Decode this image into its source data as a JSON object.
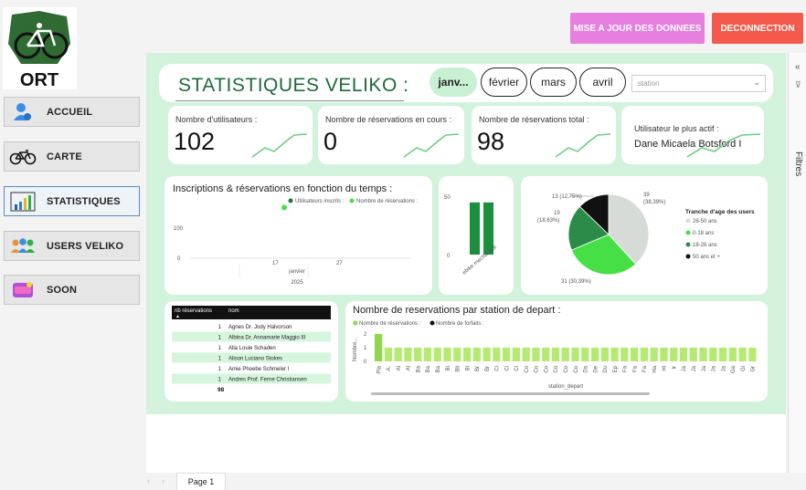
{
  "logo": {
    "text": "ORT"
  },
  "nav": [
    {
      "label": "ACCUEIL",
      "icon": "user-icon"
    },
    {
      "label": "CARTE",
      "icon": "bicycle-icon"
    },
    {
      "label": "STATISTIQUES",
      "icon": "bar-chart-icon"
    },
    {
      "label": "USERS VELIKO",
      "icon": "users-icon"
    },
    {
      "label": "SOON",
      "icon": "soon-icon"
    }
  ],
  "actions": {
    "update_label": "MISE A JOUR DES DONNEES",
    "logout_label": "DECONNECTION"
  },
  "filters": {
    "label": "Filtres",
    "collapse": "«",
    "expand": "⊽"
  },
  "header": {
    "title": "STATISTIQUES VELIKO :",
    "months": [
      "janv...",
      "février",
      "mars",
      "avril"
    ],
    "selected_month": "janv...",
    "station_placeholder": "station"
  },
  "kpis": {
    "users": {
      "label": "Nombre d'utilisateurs :",
      "value": "102"
    },
    "ongoing": {
      "label": "Nombre de réservations en cours :",
      "value": "0"
    },
    "total": {
      "label": "Nombre de réservations total :",
      "value": "98"
    },
    "active": {
      "label": "Utilisateur le plus actif :",
      "value": "Dane Micaela Botsford I"
    }
  },
  "colors": {
    "accent_green": "#4cdc4c",
    "dark_green": "#1f6a3b",
    "pink": "#e77fe0",
    "red": "#f45a4b"
  },
  "chart_data": [
    {
      "type": "scatter",
      "title": "Inscriptions & réservations en fonction du temps :",
      "legend": [
        "Utilisateurs inscrits :",
        "Nombre de réservations :"
      ],
      "y_ticks": [
        "100",
        "0"
      ],
      "x_ticks": [
        "17",
        "27"
      ],
      "xlabel_lines": [
        "janvier",
        "2025"
      ],
      "series": [
        {
          "name": "Utilisateurs inscrits :",
          "color": "#1f7a3a",
          "points": []
        },
        {
          "name": "Nombre de réservations :",
          "color": "#4cdc4c",
          "points": [
            {
              "x": 12,
              "y": 100
            }
          ]
        }
      ],
      "xlim": [
        10,
        31
      ],
      "ylim": [
        0,
        120
      ]
    },
    {
      "type": "bar",
      "categories": [
        "ebike",
        "mechanical"
      ],
      "values": [
        52,
        52
      ],
      "y_ticks": [
        "50",
        "0"
      ],
      "ylim": [
        0,
        60
      ],
      "color": "#1a8f3c",
      "category_label": "ebike mechanical"
    },
    {
      "type": "pie",
      "legend_title": "Tranche d'age des users",
      "slices": [
        {
          "name": "26-50 ans",
          "value": 39,
          "label": "39 (38,39%)",
          "color": "#d7dbd7"
        },
        {
          "name": "0-18 ans",
          "value": 31,
          "label": "31 (30,39%)",
          "color": "#46e046"
        },
        {
          "name": "18-26 ans",
          "value": 19,
          "label": "19 (18,63%)",
          "color": "#2a8c48"
        },
        {
          "name": "50 ans et +",
          "value": 13,
          "label": "13 (12,75%)",
          "color": "#111111"
        }
      ]
    },
    {
      "type": "table",
      "columns": [
        "nb réservations",
        "nom"
      ],
      "rows": [
        [
          "1",
          "Agnes Dr. Jody Halvorson"
        ],
        [
          "1",
          "Albina Dr. Annamarie Maggio III"
        ],
        [
          "1",
          "Alla Louie Schaden"
        ],
        [
          "1",
          "Alison Luciano Stokes"
        ],
        [
          "1",
          "Amie Phoebe Schmeler I"
        ],
        [
          "1",
          "Andres Prof. Ferne Christiansen"
        ]
      ],
      "total": "98"
    },
    {
      "type": "bar",
      "title": "Nombre de reservations par station de depart :",
      "legend": [
        "Nombre de réservations :",
        "Nombre de forfaits :"
      ],
      "ylabel": "Nombre...",
      "xlabel": "station_depart",
      "y_ticks": [
        "2",
        "1",
        "0"
      ],
      "ylim": [
        0,
        2
      ],
      "highlight_value": 2,
      "default_value": 1,
      "categories": [
        "Pla",
        "A.",
        "Al",
        "Al",
        "Ba",
        "Ba",
        "Ba",
        "Bi",
        "Bli",
        "Bi",
        "Br",
        "Br",
        "Ci",
        "Ci",
        "Ci",
        "Co",
        "Co",
        "Co",
        "Co",
        "Co",
        "Co",
        "Da",
        "De",
        "Du",
        "Ep",
        "Fa",
        "Fa",
        "Fa",
        "Ha",
        "Hi",
        "Ir",
        "Ja",
        "Ja",
        "Ja",
        "Ja",
        "Ja",
        "Ga",
        "Gi",
        "Gr"
      ],
      "values": [
        2,
        1,
        1,
        1,
        1,
        1,
        1,
        1,
        1,
        1,
        1,
        1,
        1,
        1,
        1,
        1,
        1,
        1,
        1,
        1,
        1,
        1,
        1,
        1,
        1,
        1,
        1,
        1,
        1,
        1,
        1,
        1,
        1,
        1,
        1,
        1,
        1,
        1,
        1
      ],
      "color": "#b5ea72",
      "highlight_color": "#8ed84e"
    }
  ],
  "footer": {
    "page_tab": "Page 1",
    "prev": "‹",
    "next": "›"
  }
}
